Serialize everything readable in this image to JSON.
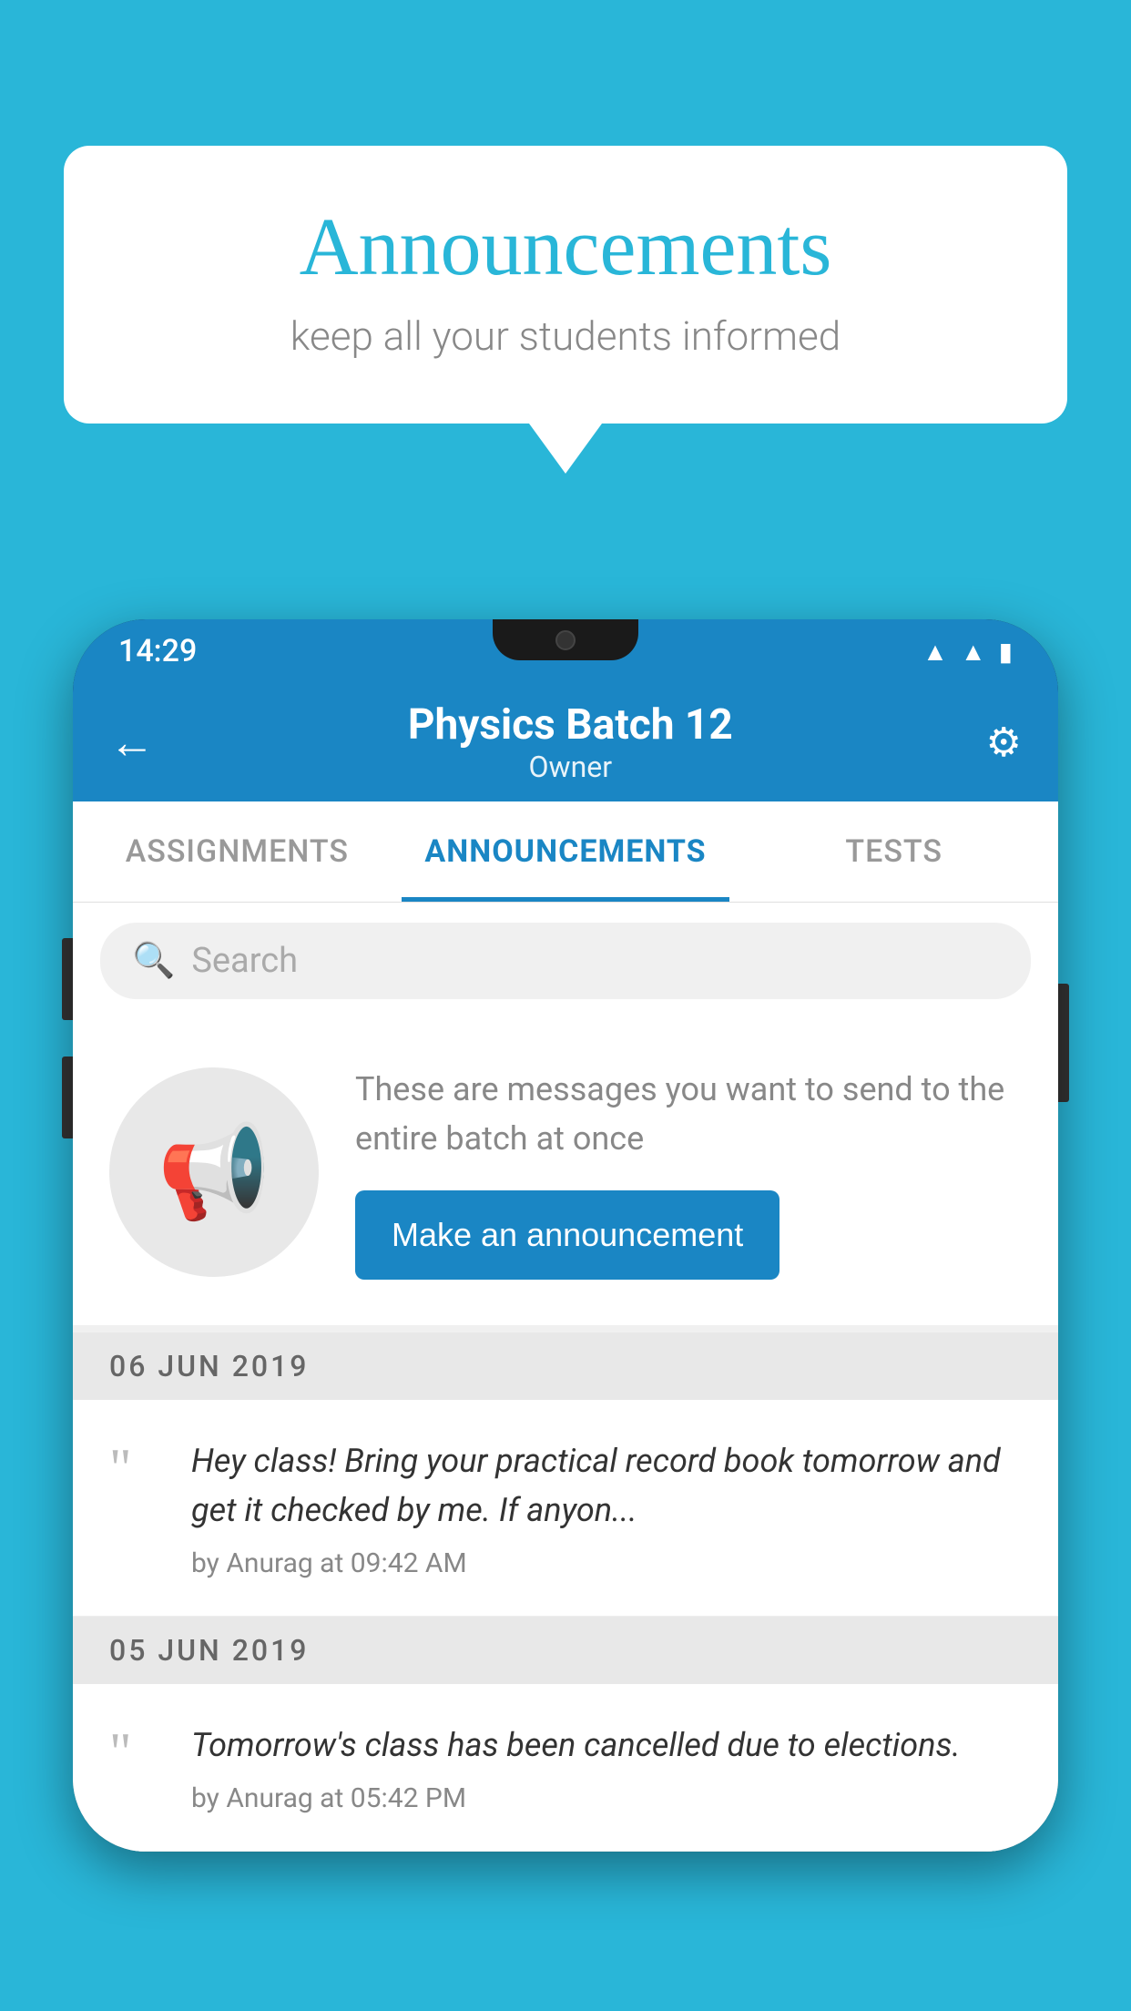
{
  "background_color": "#29b6d8",
  "speech_bubble": {
    "title": "Announcements",
    "subtitle": "keep all your students informed"
  },
  "phone": {
    "status_bar": {
      "time": "14:29",
      "icons": [
        "wifi",
        "signal",
        "battery"
      ]
    },
    "header": {
      "title": "Physics Batch 12",
      "subtitle": "Owner",
      "back_label": "←",
      "gear_label": "⚙"
    },
    "tabs": [
      {
        "label": "ASSIGNMENTS",
        "active": false
      },
      {
        "label": "ANNOUNCEMENTS",
        "active": true
      },
      {
        "label": "TESTS",
        "active": false
      }
    ],
    "search": {
      "placeholder": "Search"
    },
    "promo": {
      "description": "These are messages you want to send to the entire batch at once",
      "button_label": "Make an announcement"
    },
    "announcements": [
      {
        "date": "06  JUN  2019",
        "text": "Hey class! Bring your practical record book tomorrow and get it checked by me. If anyon...",
        "meta": "by Anurag at 09:42 AM"
      },
      {
        "date": "05  JUN  2019",
        "text": "Tomorrow's class has been cancelled due to elections.",
        "meta": "by Anurag at 05:42 PM"
      }
    ]
  }
}
